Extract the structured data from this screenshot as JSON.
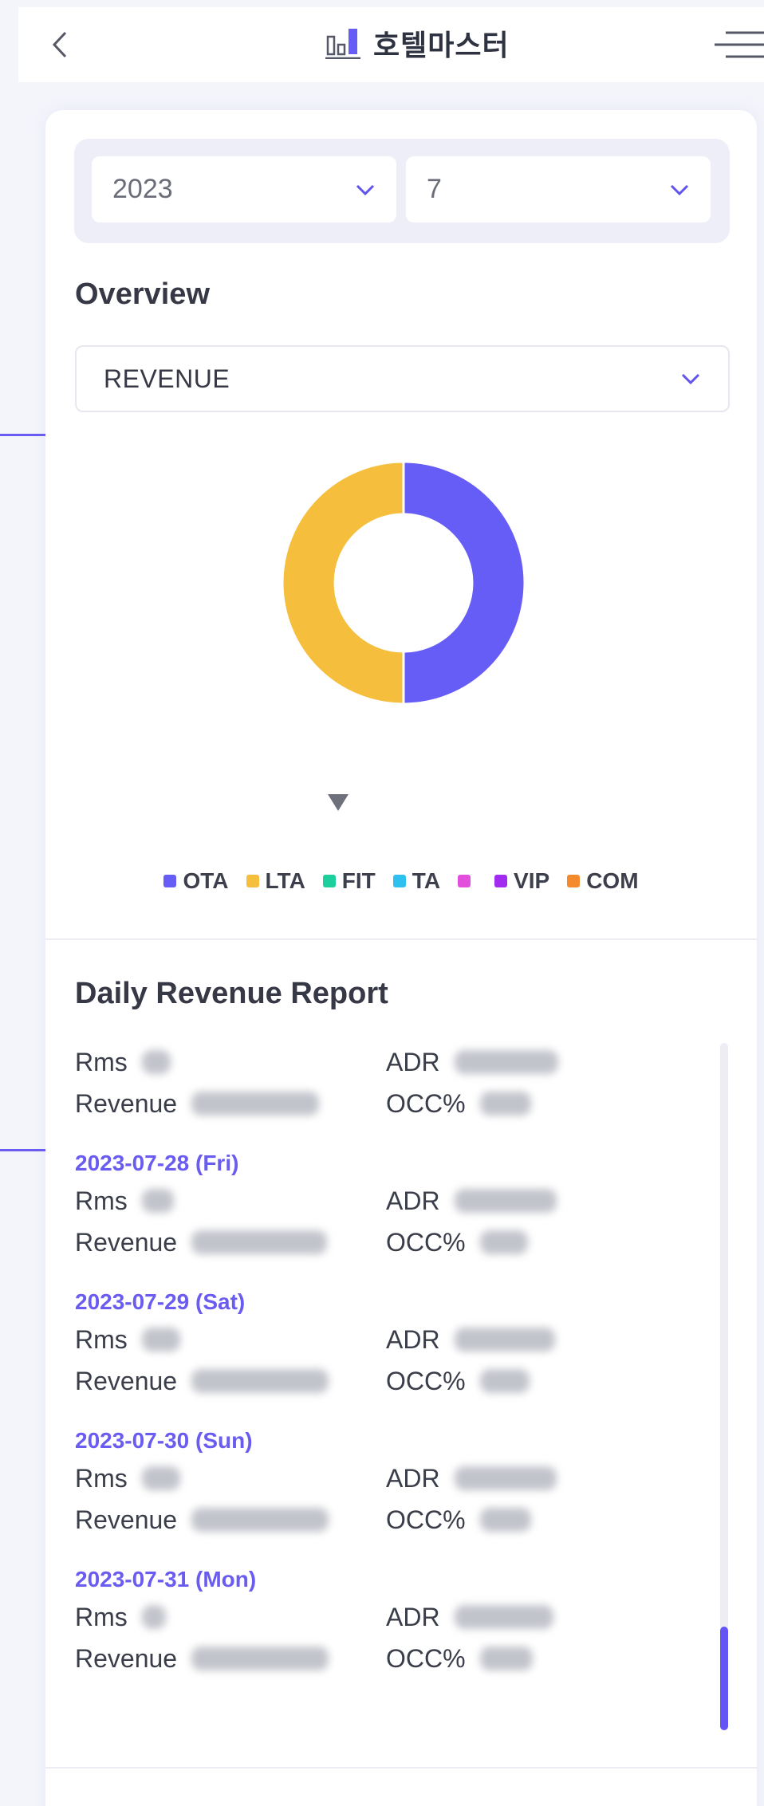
{
  "header": {
    "title": "호텔마스터",
    "back_icon": "chevron-left-icon",
    "logo_icon": "bar-chart-icon",
    "menu_icon": "hamburger-menu-icon"
  },
  "filters": {
    "year": "2023",
    "month": "7"
  },
  "overview": {
    "title": "Overview",
    "metric": "REVENUE"
  },
  "chart_data": {
    "type": "pie",
    "donut": true,
    "categories": [
      "OTA",
      "LTA"
    ],
    "values": [
      50,
      50
    ],
    "colors": [
      "#665cf6",
      "#f5be3c"
    ]
  },
  "legend": [
    {
      "label": "OTA",
      "color": "#665cf6"
    },
    {
      "label": "LTA",
      "color": "#f5be3c"
    },
    {
      "label": "FIT",
      "color": "#1ccf9c"
    },
    {
      "label": "TA",
      "color": "#2ec0ee"
    },
    {
      "label": "",
      "color": "#e24fdd"
    },
    {
      "label": "VIP",
      "color": "#a12cf0"
    },
    {
      "label": "COM",
      "color": "#f58a2c"
    }
  ],
  "report": {
    "title": "Daily Revenue Report",
    "labels": {
      "rms": "Rms",
      "adr": "ADR",
      "revenue": "Revenue",
      "occ": "OCC%"
    },
    "entries": [
      {
        "date": ""
      },
      {
        "date": "2023-07-28 (Fri)"
      },
      {
        "date": "2023-07-29 (Sat)"
      },
      {
        "date": "2023-07-30 (Sun)"
      },
      {
        "date": "2023-07-31 (Mon)"
      }
    ]
  },
  "colors": {
    "accent": "#6a5cf0",
    "ota": "#665cf6",
    "lta": "#f5be3c"
  }
}
